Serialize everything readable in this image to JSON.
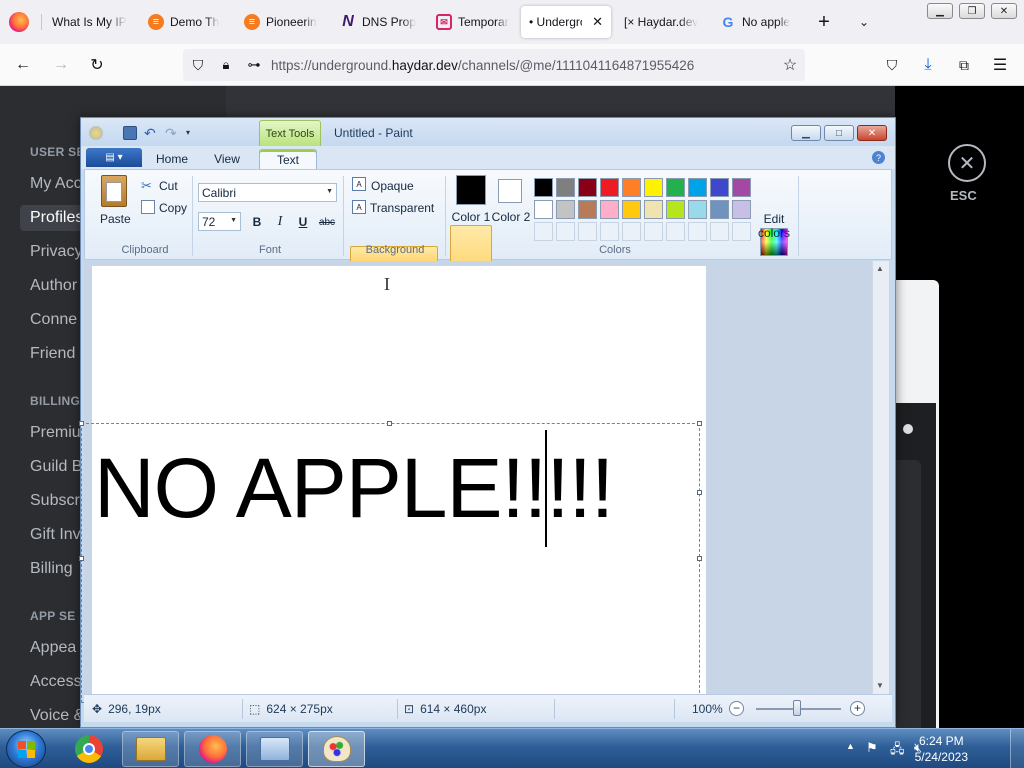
{
  "browser": {
    "tabs": [
      {
        "label": "What Is My IP",
        "icon": "firefox-icon"
      },
      {
        "label": "Demo Th",
        "icon": "demo-icon"
      },
      {
        "label": "Pioneerin",
        "icon": "pioneer-icon"
      },
      {
        "label": "DNS Prop",
        "icon": "n-icon"
      },
      {
        "label": "Temporar",
        "icon": "mail-icon"
      },
      {
        "label": "• Undergro",
        "icon": "",
        "active": true
      },
      {
        "label": "[× Haydar.dev",
        "icon": ""
      },
      {
        "label": "No apple",
        "icon": "google-icon"
      }
    ],
    "url_prefix": "https://underground.",
    "url_domain": "haydar.dev",
    "url_path": "/channels/@me/1111041164871955426"
  },
  "discord": {
    "sections": [
      {
        "heading": "USER SE",
        "items": [
          "My Acc",
          "Profiles",
          "Privacy",
          "Author",
          "Conne",
          "Friend"
        ]
      },
      {
        "heading": "BILLING",
        "items": [
          "Premiu",
          "Guild B",
          "Subscr",
          "Gift Inv",
          "Billing"
        ]
      },
      {
        "heading": "APP SE",
        "items": [
          "Appea",
          "Access",
          "Voice &"
        ]
      }
    ],
    "selected": "Profiles",
    "esc_label": "ESC"
  },
  "paint": {
    "title": "Untitled - Paint",
    "contextual_tab": "Text Tools",
    "tabs": [
      "Home",
      "View",
      "Text"
    ],
    "active_tab": "Text",
    "clipboard": {
      "paste": "Paste",
      "cut": "Cut",
      "copy": "Copy",
      "label": "Clipboard"
    },
    "font": {
      "family": "Calibri",
      "size": "72",
      "label": "Font",
      "bold": "B",
      "italic": "I",
      "underline": "U",
      "strike": "abc"
    },
    "background": {
      "opaque": "Opaque",
      "transparent": "Transparent",
      "label": "Background",
      "selected": "Transparent"
    },
    "colors": {
      "color1": "Color 1",
      "color2": "Color 2",
      "color1_value": "#000000",
      "color2_value": "#ffffff",
      "label": "Colors",
      "edit": "Edit colors",
      "palette_row1": [
        "#000000",
        "#7f7f7f",
        "#880015",
        "#ed1c24",
        "#ff7f27",
        "#fff200",
        "#22b14c",
        "#00a2e8",
        "#3f48cc",
        "#a349a4"
      ],
      "palette_row2": [
        "#ffffff",
        "#c3c3c3",
        "#b97a57",
        "#ffaec9",
        "#ffc90e",
        "#efe4b0",
        "#b5e61d",
        "#99d9ea",
        "#7092be",
        "#c8bfe7"
      ]
    },
    "canvas_text": "NO APPLE!!!!!",
    "status": {
      "cursor_pos": "296, 19px",
      "selection": "624 × 275px",
      "image_size": "614 × 460px",
      "zoom": "100%"
    }
  },
  "taskbar": {
    "apps": [
      "chrome-icon",
      "explorer-icon",
      "firefox-icon",
      "control-panel-icon",
      "paint-icon"
    ],
    "time": "6:24 PM",
    "date": "5/24/2023"
  }
}
